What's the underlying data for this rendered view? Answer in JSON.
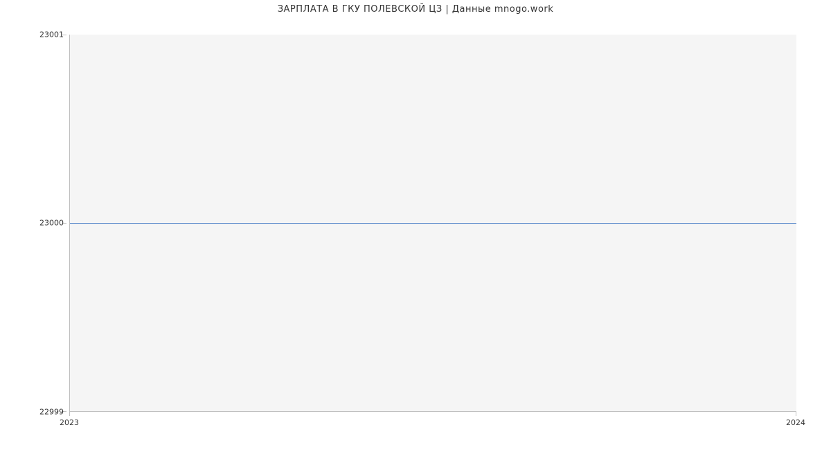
{
  "chart_data": {
    "type": "line",
    "title": "ЗАРПЛАТА В ГКУ ПОЛЕВСКОЙ ЦЗ | Данные mnogo.work",
    "x": [
      2023,
      2024
    ],
    "values": [
      23000,
      23000
    ],
    "x_ticks": [
      "2023",
      "2024"
    ],
    "y_ticks": [
      "22999",
      "23000",
      "23001"
    ],
    "xlim": [
      2023,
      2024
    ],
    "ylim": [
      22999,
      23001
    ],
    "xlabel": "",
    "ylabel": ""
  }
}
